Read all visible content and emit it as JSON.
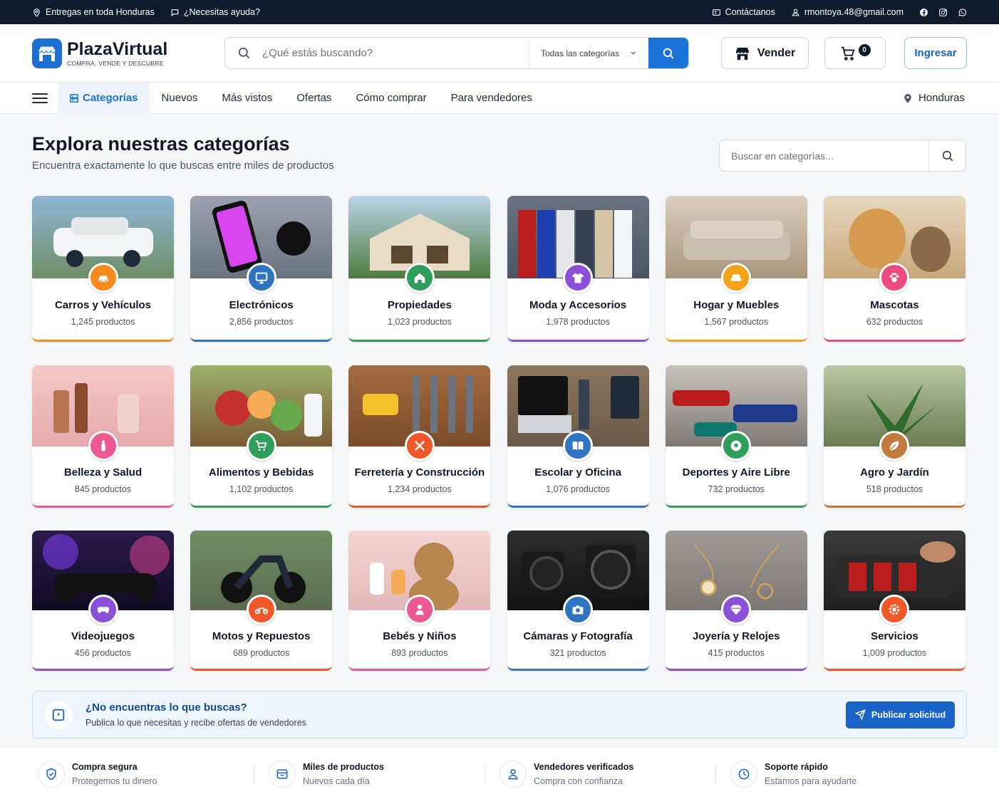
{
  "topbar": {
    "delivery": "Entregas en toda Honduras",
    "help": "¿Necesitas ayuda?",
    "contact": "Contáctanos",
    "email": "rmontoya.48@gmail.com"
  },
  "header": {
    "logo_title": "PlazaVirtual",
    "logo_sub": "COMPRA, VENDE Y DESCUBRE",
    "search_placeholder": "¿Qué estás buscando?",
    "category_select": "Todas las categorías",
    "sell_label": "Vender",
    "cart_count": "0",
    "login_label": "Ingresar"
  },
  "nav": {
    "categories": "Categorías",
    "links": [
      "Nuevos",
      "Más vistos",
      "Ofertas",
      "Cómo comprar",
      "Para vendedores"
    ],
    "location": "Honduras"
  },
  "hero": {
    "title": "Explora nuestras categorías",
    "subtitle": "Encuentra exactamente lo que buscas entre miles de productos",
    "search_placeholder": "Buscar en categorías..."
  },
  "categories": [
    {
      "name": "Carros y Vehículos",
      "count": "1,245 productos",
      "color": "#f58a1f",
      "icon": "car-icon"
    },
    {
      "name": "Electrónicos",
      "count": "2,856 productos",
      "color": "#2f74c0",
      "icon": "monitor-icon"
    },
    {
      "name": "Propiedades",
      "count": "1,023 productos",
      "color": "#2e9e5b",
      "icon": "house-icon"
    },
    {
      "name": "Moda y Accesorios",
      "count": "1,978 productos",
      "color": "#8b4fd8",
      "icon": "shirt-icon"
    },
    {
      "name": "Hogar y Muebles",
      "count": "1,567 productos",
      "color": "#f5a21b",
      "icon": "sofa-icon"
    },
    {
      "name": "Mascotas",
      "count": "632 productos",
      "color": "#ec4b7f",
      "icon": "paw-icon"
    },
    {
      "name": "Belleza y Salud",
      "count": "845 productos",
      "color": "#ec5a93",
      "icon": "beauty-icon"
    },
    {
      "name": "Alimentos y Bebidas",
      "count": "1,102 productos",
      "color": "#2e9e5b",
      "icon": "cart-icon"
    },
    {
      "name": "Ferretería y Construcción",
      "count": "1,234 productos",
      "color": "#f0582a",
      "icon": "tools-icon"
    },
    {
      "name": "Escolar y Oficina",
      "count": "1,076 productos",
      "color": "#2f74c0",
      "icon": "book-icon"
    },
    {
      "name": "Deportes y Aire Libre",
      "count": "732 productos",
      "color": "#2e9e5b",
      "icon": "ball-icon"
    },
    {
      "name": "Agro y Jardín",
      "count": "518 productos",
      "color": "#c47a3c",
      "icon": "leaf-icon"
    },
    {
      "name": "Videojuegos",
      "count": "456 productos",
      "color": "#8b4fd8",
      "icon": "gamepad-icon"
    },
    {
      "name": "Motos y Repuestos",
      "count": "689 productos",
      "color": "#f0582a",
      "icon": "motorcycle-icon"
    },
    {
      "name": "Bebés y Niños",
      "count": "893 productos",
      "color": "#ec5a93",
      "icon": "baby-icon"
    },
    {
      "name": "Cámaras y Fotografía",
      "count": "321 productos",
      "color": "#2f74c0",
      "icon": "camera-icon"
    },
    {
      "name": "Joyería y Relojes",
      "count": "415 productos",
      "color": "#8b4fd8",
      "icon": "diamond-icon"
    },
    {
      "name": "Servicios",
      "count": "1,009 productos",
      "color": "#f0582a",
      "icon": "gear-icon"
    }
  ],
  "banner": {
    "title": "¿No encuentras lo que buscas?",
    "text": "Publica lo que necesitas y recibe ofertas de vendedores",
    "button": "Publicar solicitud"
  },
  "features": [
    {
      "title": "Compra segura",
      "text": "Protegemos tu dinero",
      "icon": "shield-icon"
    },
    {
      "title": "Miles de productos",
      "text": "Nuevos cada día",
      "icon": "store-icon"
    },
    {
      "title": "Vendedores verificados",
      "text": "Compra con confianza",
      "icon": "user-icon"
    },
    {
      "title": "Soporte rápido",
      "text": "Estamos para ayudarte",
      "icon": "clock-icon"
    }
  ]
}
